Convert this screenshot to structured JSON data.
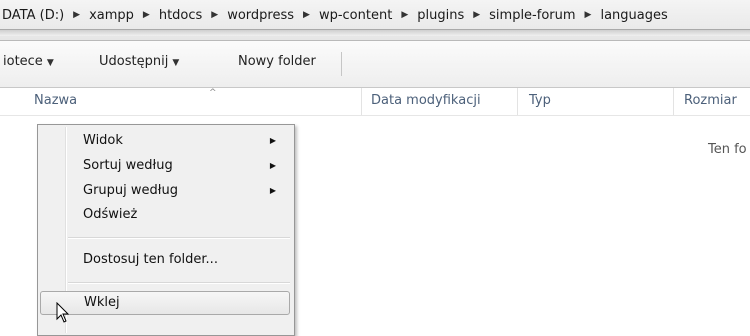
{
  "breadcrumb": {
    "items": [
      "DATA (D:)",
      "xampp",
      "htdocs",
      "wordpress",
      "wp-content",
      "plugins",
      "simple-forum",
      "languages"
    ],
    "separator_icon": "chevron-right-icon"
  },
  "toolbar": {
    "library_label": "iotece",
    "share_label": "Udostępnij",
    "new_folder_label": "Nowy folder",
    "dropdown_icon": "triangle-down-icon"
  },
  "columns": {
    "name": "Nazwa",
    "modified": "Data modyfikacji",
    "type": "Typ",
    "size": "Rozmiar",
    "sort_icon": "sort-ascending-icon"
  },
  "empty_message": "Ten fo",
  "context_menu": {
    "view": "Widok",
    "sort_by": "Sortuj według",
    "group_by": "Grupuj według",
    "refresh": "Odśwież",
    "customize": "Dostosuj ten folder...",
    "paste": "Wklej",
    "submenu_icon": "submenu-arrow-icon",
    "hovered_item": "Wklej"
  },
  "colors": {
    "column_header_text": "#4c607a",
    "menu_background": "#f0f0f0",
    "toolbar_background": "#f4f4f4"
  }
}
